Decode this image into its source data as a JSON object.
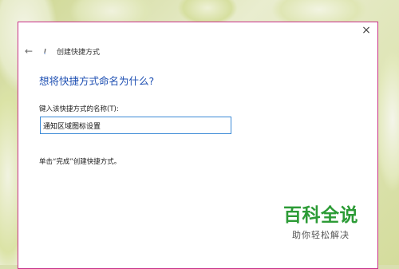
{
  "window": {
    "title": "创建快捷方式",
    "close_glyph": "×",
    "back_glyph": "←"
  },
  "main": {
    "heading": "想将快捷方式命名为什么?",
    "field_label": "键入该快捷方式的名称(T):",
    "name_value": "通知区域图标设置",
    "hint": "单击“完成”创建快捷方式。"
  },
  "watermark": {
    "title": "百科全说",
    "subtitle": "助你轻松解决"
  },
  "colors": {
    "heading": "#1e4fb2",
    "input_border": "#3c8ad6",
    "dialog_border": "#c9308a",
    "watermark": "#2c9b36"
  },
  "icons": [
    "close-icon",
    "back-arrow-icon",
    "shortcut-wizard-icon"
  ]
}
